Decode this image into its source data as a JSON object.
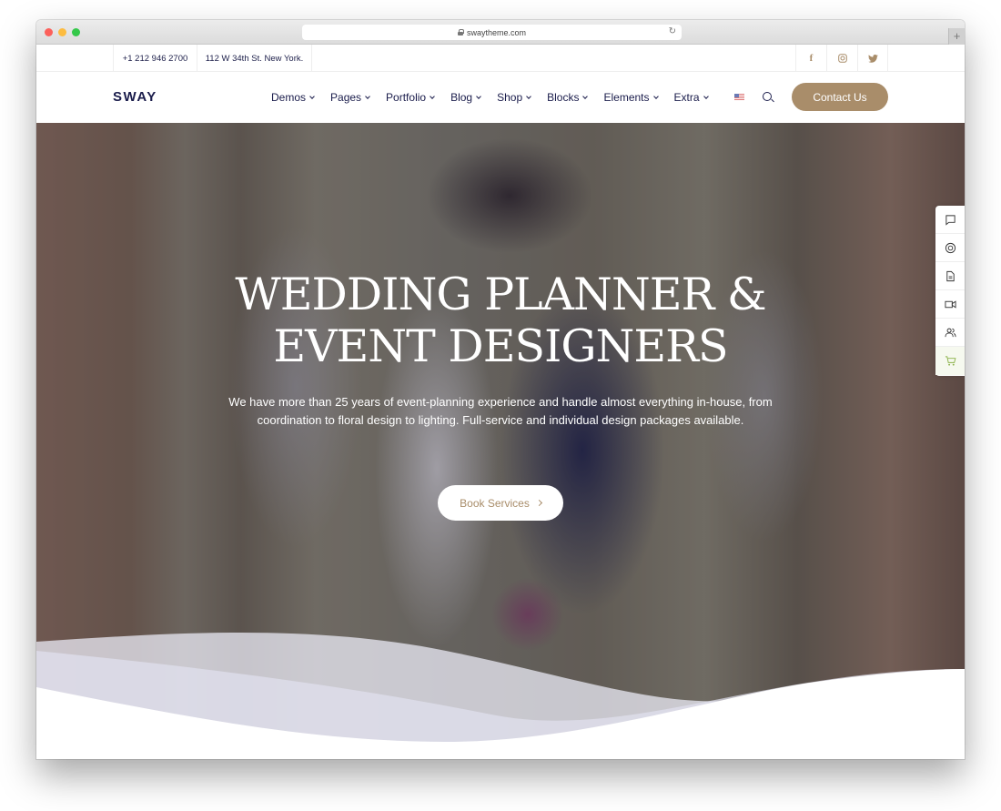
{
  "browser": {
    "url": "swaytheme.com",
    "new_tab_label": "+"
  },
  "topbar": {
    "phone": "+1 212 946 2700",
    "address": "112 W 34th St. New York.",
    "social": [
      {
        "icon": "facebook-icon",
        "glyph": "f"
      },
      {
        "icon": "instagram-icon",
        "glyph": "◎"
      },
      {
        "icon": "twitter-icon",
        "glyph": "🐦"
      }
    ]
  },
  "nav": {
    "logo": "SWAY",
    "menu": [
      {
        "label": "Demos"
      },
      {
        "label": "Pages"
      },
      {
        "label": "Portfolio"
      },
      {
        "label": "Blog"
      },
      {
        "label": "Shop"
      },
      {
        "label": "Blocks"
      },
      {
        "label": "Elements"
      },
      {
        "label": "Extra"
      }
    ],
    "contact_label": "Contact Us"
  },
  "hero": {
    "title_line1": "WEDDING PLANNER &",
    "title_line2": "EVENT DESIGNERS",
    "text": "We have more than 25 years of event-planning experience and handle almost everything in-house, from coordination to floral design to lighting. Full-service and individual design packages available.",
    "cta_label": "Book Services"
  },
  "side_panel": {
    "items": [
      {
        "icon": "chat-icon"
      },
      {
        "icon": "support-icon"
      },
      {
        "icon": "document-icon"
      },
      {
        "icon": "video-icon"
      },
      {
        "icon": "users-icon"
      },
      {
        "icon": "cart-icon"
      }
    ]
  },
  "colors": {
    "brand_dark": "#1a1c4b",
    "accent": "#a98d6a",
    "cart_accent": "#8cb24a"
  }
}
